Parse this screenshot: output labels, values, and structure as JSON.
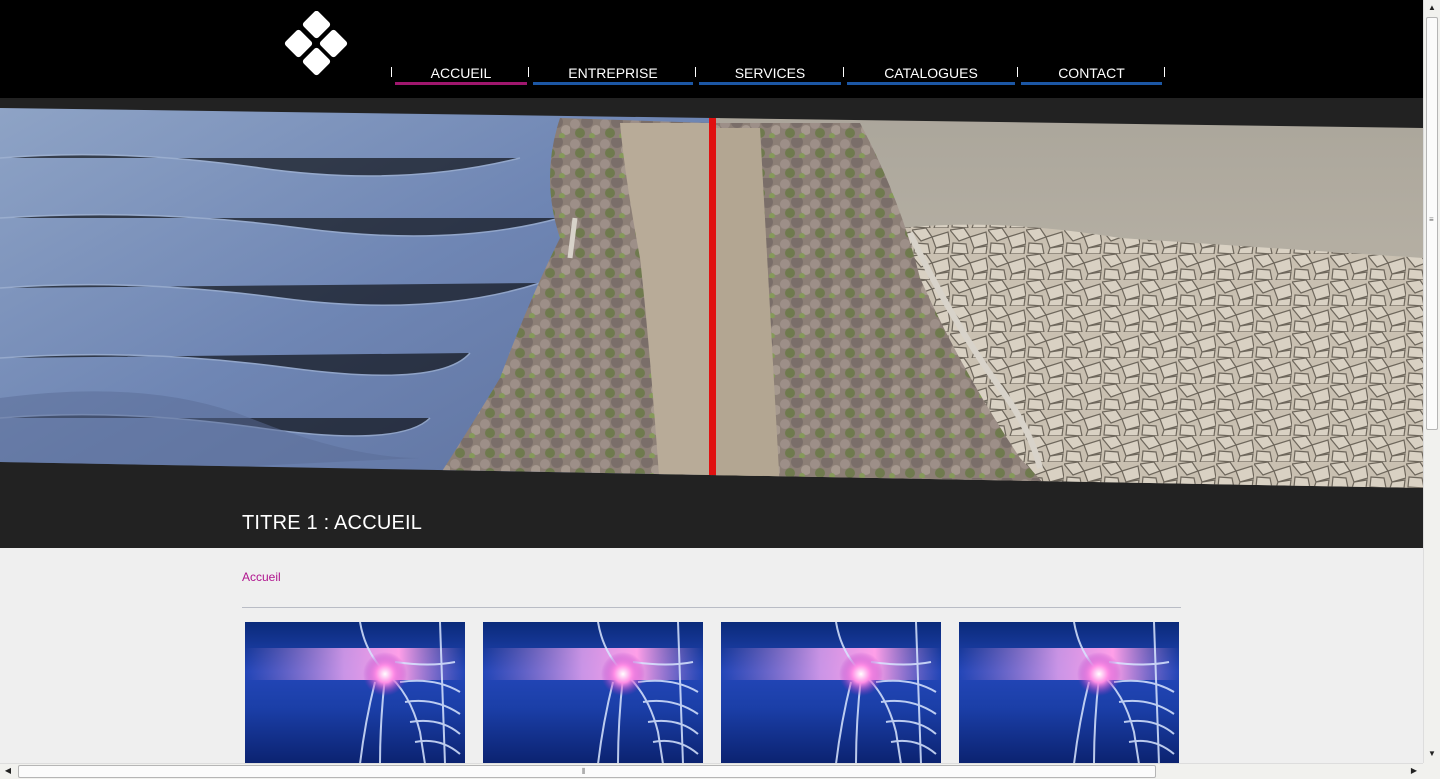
{
  "header": {
    "logo_icon": "diamond-tiles-logo-icon",
    "nav": [
      {
        "label": "ACCUEIL",
        "accent": "#a0176e",
        "active": true
      },
      {
        "label": "ENTREPRISE",
        "accent": "#1c57a5",
        "active": false
      },
      {
        "label": "SERVICES",
        "accent": "#1c57a5",
        "active": false
      },
      {
        "label": "CATALOGUES",
        "accent": "#1c57a5",
        "active": false
      },
      {
        "label": "CONTACT",
        "accent": "#1c57a5",
        "active": false
      }
    ]
  },
  "banner": {
    "image": "water-and-dry-cracked-earth-photo",
    "divider_color": "#e01010"
  },
  "main": {
    "title": "TITRE 1 : ACCUEIL",
    "breadcrumb": "Accueil",
    "breadcrumb_color": "#b0148e",
    "thumbnails": [
      {
        "image": "glowing-shoulder-skeleton-xray"
      },
      {
        "image": "glowing-shoulder-skeleton-xray"
      },
      {
        "image": "glowing-shoulder-skeleton-xray"
      },
      {
        "image": "glowing-shoulder-skeleton-xray"
      }
    ]
  },
  "colors": {
    "header_bg": "#000000",
    "band_bg": "#222222",
    "content_bg": "#efefef"
  }
}
